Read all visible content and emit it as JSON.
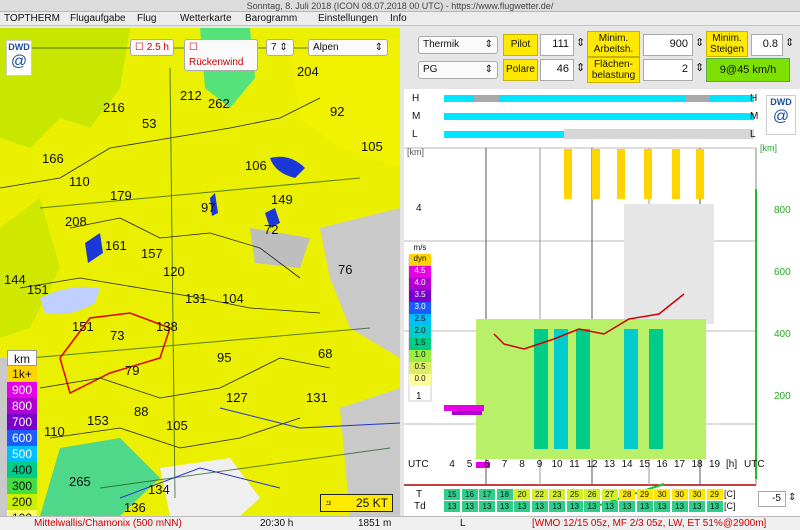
{
  "window": {
    "title": "Sonntag, 8. Juli 2018 (ICON 08.07.2018 00 UTC) - https://www.flugwetter.de/"
  },
  "menu": [
    "TOPTHERM",
    "Flugaufgabe",
    "Flug",
    "Wetterkarte",
    "Barogramm",
    "Einstellungen",
    "Info"
  ],
  "map": {
    "time_label": "2.5 h",
    "tailwind_label": "Rückenwind",
    "step_value": "7",
    "region": "Alpen",
    "numbers": [
      "204",
      "216",
      "212",
      "262",
      "92",
      "53",
      "166",
      "105",
      "110",
      "106",
      "179",
      "97",
      "149",
      "208",
      "72",
      "161",
      "157",
      "120",
      "76",
      "144",
      "151",
      "131",
      "104",
      "151",
      "138",
      "73",
      "68",
      "95",
      "79",
      "127",
      "131",
      "88",
      "105",
      "110",
      "153",
      "265",
      "134",
      "136"
    ],
    "legend_unit": "km",
    "legend": [
      {
        "label": "1k+",
        "color": "#ffd400"
      },
      {
        "label": "900",
        "color": "#e600e6"
      },
      {
        "label": "800",
        "color": "#b000d0"
      },
      {
        "label": "700",
        "color": "#7a00cc"
      },
      {
        "label": "600",
        "color": "#1c5cff"
      },
      {
        "label": "500",
        "color": "#00bfff"
      },
      {
        "label": "400",
        "color": "#00cc88"
      },
      {
        "label": "300",
        "color": "#44dd44"
      },
      {
        "label": "200",
        "color": "#c8ee00"
      },
      {
        "label": "100",
        "color": "#ffff66"
      }
    ],
    "wind_label": "25 KT",
    "dwd_label": "DWD"
  },
  "controls": {
    "mode": "Thermik",
    "pilot_label": "Pilot",
    "pilot_value": "111",
    "min_work_label": "Minim. Arbeitsh.",
    "min_work_value": "900",
    "min_climb_label": "Minim. Steigen",
    "min_climb_value": "0.8",
    "glider": "PG",
    "polar_label": "Polare",
    "polar_value": "46",
    "wing_load_label": "Flächen-belastung",
    "wing_load_value": "2",
    "result": "9@45 km/h"
  },
  "sounding": {
    "cloud_rows": [
      "H",
      "M",
      "L"
    ],
    "km_label": "[km]",
    "m_label": "[km]",
    "alt_left": [
      "4",
      "1"
    ],
    "alt_right": [
      "800",
      "600",
      "400",
      "200"
    ],
    "climb_unit": "m/s",
    "climb_scale": [
      {
        "label": "dyn",
        "color": "#ffd400"
      },
      {
        "label": "4.5",
        "color": "#e600e6"
      },
      {
        "label": "4.0",
        "color": "#b000d0"
      },
      {
        "label": "3.5",
        "color": "#7a00cc"
      },
      {
        "label": "3.0",
        "color": "#1c5cff"
      },
      {
        "label": "2.5",
        "color": "#00bfff"
      },
      {
        "label": "2.0",
        "color": "#00cccc"
      },
      {
        "label": "1.5",
        "color": "#00cc88"
      },
      {
        "label": "1.0",
        "color": "#99ee44"
      },
      {
        "label": "0.5",
        "color": "#ddee66"
      },
      {
        "label": "0.0",
        "color": "#ffff99"
      }
    ],
    "hours": [
      "4",
      "5",
      "6",
      "7",
      "8",
      "9",
      "10",
      "11",
      "12",
      "13",
      "14",
      "15",
      "16",
      "17",
      "18",
      "19"
    ],
    "utc_label": "UTC",
    "hour_unit": "[h]",
    "T_label": "T",
    "Td_label": "Td",
    "T": [
      "15",
      "16",
      "17",
      "18",
      "20",
      "22",
      "23",
      "25",
      "26",
      "27",
      "28",
      "29",
      "30",
      "30",
      "30",
      "29"
    ],
    "Td": [
      "13",
      "13",
      "13",
      "13",
      "13",
      "13",
      "13",
      "13",
      "13",
      "13",
      "13",
      "13",
      "13",
      "13",
      "13",
      "13"
    ],
    "temp_unit": "[C]",
    "offset_value": "-5"
  },
  "status": {
    "location": "Mittelwallis/Chamonix (500 mNN)",
    "time": "20:30 h",
    "alt": "1851 m",
    "layer": "L",
    "info": "[WMO 12/15 05z, MF 2/3 05z, LW, ET  51%@2900m]"
  }
}
